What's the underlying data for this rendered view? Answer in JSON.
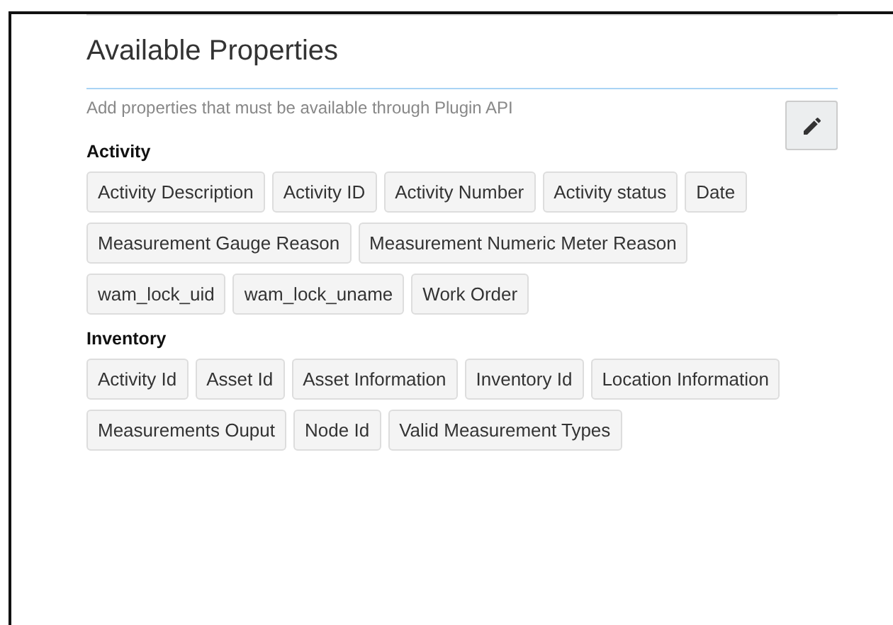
{
  "panel": {
    "title": "Available Properties",
    "description": "Add properties that must be available through Plugin API"
  },
  "groups": [
    {
      "name": "Activity",
      "properties": [
        "Activity Description",
        "Activity ID",
        "Activity Number",
        "Activity status",
        "Date",
        "Measurement Gauge Reason",
        "Measurement Numeric Meter Reason",
        "wam_lock_uid",
        "wam_lock_uname",
        "Work Order"
      ]
    },
    {
      "name": "Inventory",
      "properties": [
        "Activity Id",
        "Asset Id",
        "Asset Information",
        "Inventory Id",
        "Location Information",
        "Measurements Ouput",
        "Node Id",
        "Valid Measurement Types"
      ]
    }
  ]
}
